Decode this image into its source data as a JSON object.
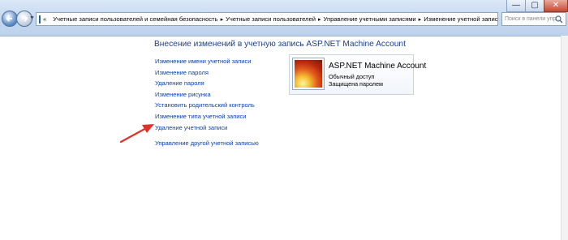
{
  "window": {
    "controls": {
      "minimize": "—",
      "maximize": "▢",
      "close": "✕"
    }
  },
  "navigation": {
    "back_icon": "back-arrow-icon",
    "forward_icon": "forward-arrow-icon"
  },
  "address_bar": {
    "prefix": "«",
    "crumbs": [
      "Учетные записи пользователей и семейная безопасность",
      "Учетные записи пользователей",
      "Управление учетными записями",
      "Изменение учетной записи"
    ]
  },
  "search": {
    "placeholder": "Поиск в панели упр..."
  },
  "main": {
    "heading": "Внесение изменений в учетную запись ASP.NET Machine Account",
    "tasks": [
      "Изменение имени учетной записи",
      "Изменение пароля",
      "Удаление пароля",
      "Изменение рисунка",
      "Установить родительский контроль",
      "Изменение типа учетной записи",
      "Удаление учетной записи",
      "Управление другой учетной записью"
    ]
  },
  "account": {
    "name": "ASP.NET Machine Account",
    "type": "Обычный доступ",
    "status": "Защищена паролем"
  },
  "colors": {
    "link": "#0a3fa6",
    "heading": "#1e3f8c",
    "arrow": "#e0312b"
  }
}
